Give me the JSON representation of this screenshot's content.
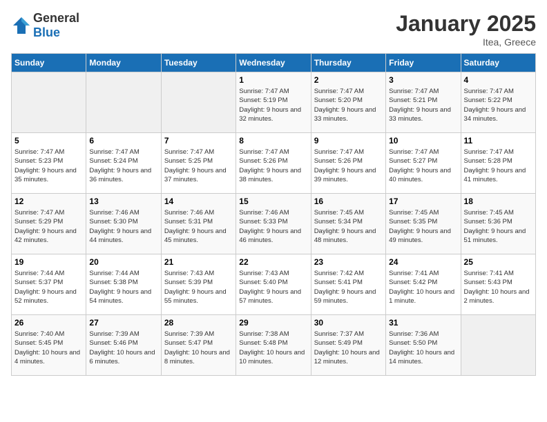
{
  "header": {
    "logo_general": "General",
    "logo_blue": "Blue",
    "month": "January 2025",
    "location": "Itea, Greece"
  },
  "columns": [
    "Sunday",
    "Monday",
    "Tuesday",
    "Wednesday",
    "Thursday",
    "Friday",
    "Saturday"
  ],
  "weeks": [
    [
      {
        "day": "",
        "text": ""
      },
      {
        "day": "",
        "text": ""
      },
      {
        "day": "",
        "text": ""
      },
      {
        "day": "1",
        "text": "Sunrise: 7:47 AM\nSunset: 5:19 PM\nDaylight: 9 hours and 32 minutes."
      },
      {
        "day": "2",
        "text": "Sunrise: 7:47 AM\nSunset: 5:20 PM\nDaylight: 9 hours and 33 minutes."
      },
      {
        "day": "3",
        "text": "Sunrise: 7:47 AM\nSunset: 5:21 PM\nDaylight: 9 hours and 33 minutes."
      },
      {
        "day": "4",
        "text": "Sunrise: 7:47 AM\nSunset: 5:22 PM\nDaylight: 9 hours and 34 minutes."
      }
    ],
    [
      {
        "day": "5",
        "text": "Sunrise: 7:47 AM\nSunset: 5:23 PM\nDaylight: 9 hours and 35 minutes."
      },
      {
        "day": "6",
        "text": "Sunrise: 7:47 AM\nSunset: 5:24 PM\nDaylight: 9 hours and 36 minutes."
      },
      {
        "day": "7",
        "text": "Sunrise: 7:47 AM\nSunset: 5:25 PM\nDaylight: 9 hours and 37 minutes."
      },
      {
        "day": "8",
        "text": "Sunrise: 7:47 AM\nSunset: 5:26 PM\nDaylight: 9 hours and 38 minutes."
      },
      {
        "day": "9",
        "text": "Sunrise: 7:47 AM\nSunset: 5:26 PM\nDaylight: 9 hours and 39 minutes."
      },
      {
        "day": "10",
        "text": "Sunrise: 7:47 AM\nSunset: 5:27 PM\nDaylight: 9 hours and 40 minutes."
      },
      {
        "day": "11",
        "text": "Sunrise: 7:47 AM\nSunset: 5:28 PM\nDaylight: 9 hours and 41 minutes."
      }
    ],
    [
      {
        "day": "12",
        "text": "Sunrise: 7:47 AM\nSunset: 5:29 PM\nDaylight: 9 hours and 42 minutes."
      },
      {
        "day": "13",
        "text": "Sunrise: 7:46 AM\nSunset: 5:30 PM\nDaylight: 9 hours and 44 minutes."
      },
      {
        "day": "14",
        "text": "Sunrise: 7:46 AM\nSunset: 5:31 PM\nDaylight: 9 hours and 45 minutes."
      },
      {
        "day": "15",
        "text": "Sunrise: 7:46 AM\nSunset: 5:33 PM\nDaylight: 9 hours and 46 minutes."
      },
      {
        "day": "16",
        "text": "Sunrise: 7:45 AM\nSunset: 5:34 PM\nDaylight: 9 hours and 48 minutes."
      },
      {
        "day": "17",
        "text": "Sunrise: 7:45 AM\nSunset: 5:35 PM\nDaylight: 9 hours and 49 minutes."
      },
      {
        "day": "18",
        "text": "Sunrise: 7:45 AM\nSunset: 5:36 PM\nDaylight: 9 hours and 51 minutes."
      }
    ],
    [
      {
        "day": "19",
        "text": "Sunrise: 7:44 AM\nSunset: 5:37 PM\nDaylight: 9 hours and 52 minutes."
      },
      {
        "day": "20",
        "text": "Sunrise: 7:44 AM\nSunset: 5:38 PM\nDaylight: 9 hours and 54 minutes."
      },
      {
        "day": "21",
        "text": "Sunrise: 7:43 AM\nSunset: 5:39 PM\nDaylight: 9 hours and 55 minutes."
      },
      {
        "day": "22",
        "text": "Sunrise: 7:43 AM\nSunset: 5:40 PM\nDaylight: 9 hours and 57 minutes."
      },
      {
        "day": "23",
        "text": "Sunrise: 7:42 AM\nSunset: 5:41 PM\nDaylight: 9 hours and 59 minutes."
      },
      {
        "day": "24",
        "text": "Sunrise: 7:41 AM\nSunset: 5:42 PM\nDaylight: 10 hours and 1 minute."
      },
      {
        "day": "25",
        "text": "Sunrise: 7:41 AM\nSunset: 5:43 PM\nDaylight: 10 hours and 2 minutes."
      }
    ],
    [
      {
        "day": "26",
        "text": "Sunrise: 7:40 AM\nSunset: 5:45 PM\nDaylight: 10 hours and 4 minutes."
      },
      {
        "day": "27",
        "text": "Sunrise: 7:39 AM\nSunset: 5:46 PM\nDaylight: 10 hours and 6 minutes."
      },
      {
        "day": "28",
        "text": "Sunrise: 7:39 AM\nSunset: 5:47 PM\nDaylight: 10 hours and 8 minutes."
      },
      {
        "day": "29",
        "text": "Sunrise: 7:38 AM\nSunset: 5:48 PM\nDaylight: 10 hours and 10 minutes."
      },
      {
        "day": "30",
        "text": "Sunrise: 7:37 AM\nSunset: 5:49 PM\nDaylight: 10 hours and 12 minutes."
      },
      {
        "day": "31",
        "text": "Sunrise: 7:36 AM\nSunset: 5:50 PM\nDaylight: 10 hours and 14 minutes."
      },
      {
        "day": "",
        "text": ""
      }
    ]
  ]
}
